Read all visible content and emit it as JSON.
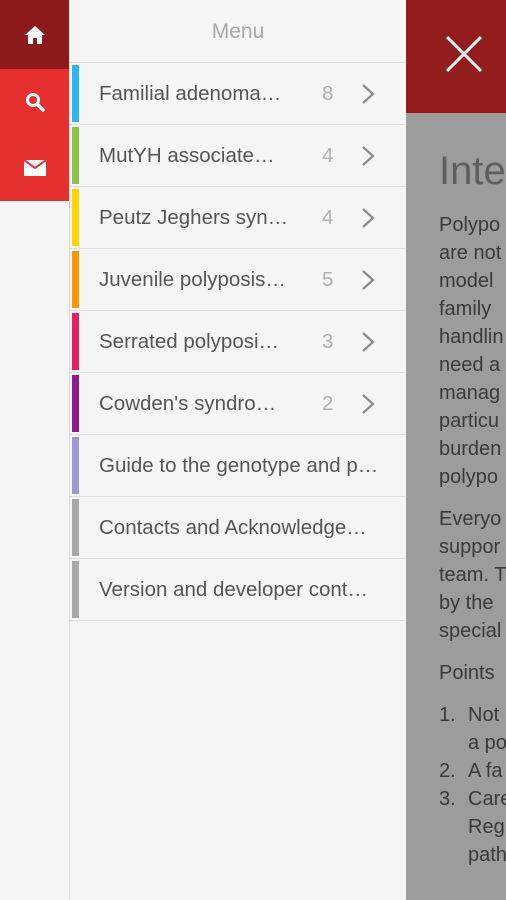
{
  "rail": {
    "home_icon": "home-icon",
    "search_icon": "search-icon",
    "mail_icon": "mail-icon",
    "colors": {
      "home_bg": "#8e1b1b",
      "accent_bg": "#e63030"
    }
  },
  "menu": {
    "title": "Menu",
    "items": [
      {
        "label": "Familial adenoma…",
        "count": "8",
        "color": "#29b6f6",
        "has_chevron": true
      },
      {
        "label": "MutYH associate…",
        "count": "4",
        "color": "#8bc34a",
        "has_chevron": true
      },
      {
        "label": "Peutz Jeghers syn…",
        "count": "4",
        "color": "#ffd600",
        "has_chevron": true
      },
      {
        "label": "Juvenile polyposis…",
        "count": "5",
        "color": "#ff9800",
        "has_chevron": true
      },
      {
        "label": "Serrated polyposi…",
        "count": "3",
        "color": "#e91e63",
        "has_chevron": true
      },
      {
        "label": "Cowden's syndro…",
        "count": "2",
        "color": "#8e1a8e",
        "has_chevron": true
      },
      {
        "label": "Guide to the genotype and p…",
        "count": "",
        "color": "#9e97d6",
        "has_chevron": false
      },
      {
        "label": "Contacts and Acknowledge…",
        "count": "",
        "color": "#a8a8a8",
        "has_chevron": false
      },
      {
        "label": "Version and developer cont…",
        "count": "",
        "color": "#a8a8a8",
        "has_chevron": false
      }
    ]
  },
  "content": {
    "close_icon": "close-icon",
    "heading": "Inte",
    "para1": [
      "Polypo",
      "are not",
      "model",
      "family",
      "handlin",
      "need a",
      "manag",
      "particu",
      "burden",
      "polypo"
    ],
    "para2": [
      "Everyo",
      "suppor",
      "team. T",
      "by the",
      "special"
    ],
    "points_title": "Points",
    "points": [
      {
        "num": "1.",
        "lines": [
          "Not",
          "a po"
        ]
      },
      {
        "num": "2.",
        "lines": [
          "A fa"
        ]
      },
      {
        "num": "3.",
        "lines": [
          "Care",
          "Reg",
          "path"
        ]
      }
    ]
  }
}
